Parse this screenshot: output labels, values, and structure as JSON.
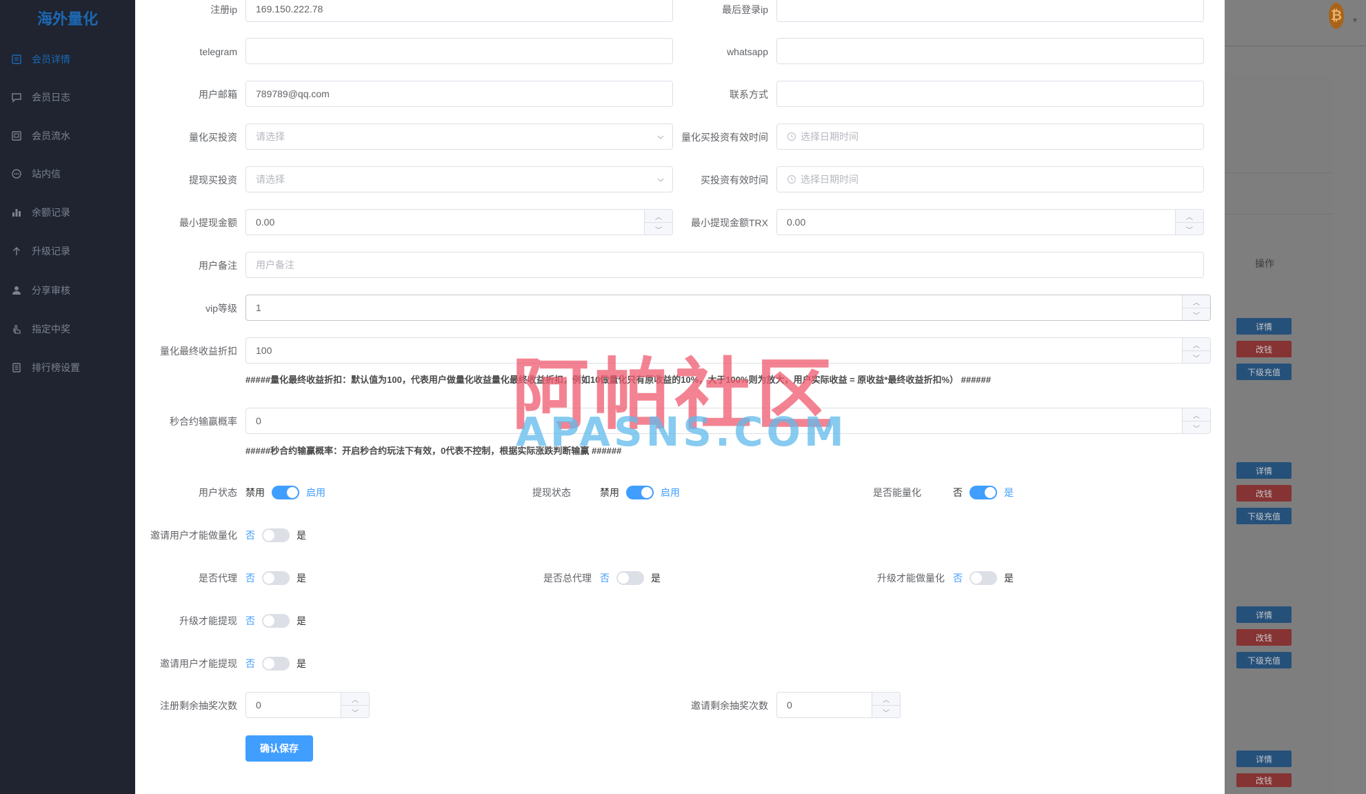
{
  "app": {
    "title": "海外量化"
  },
  "sidebar": {
    "items": [
      {
        "label": "会员详情",
        "icon": "document-icon",
        "active": true
      },
      {
        "label": "会员日志",
        "icon": "chat-icon"
      },
      {
        "label": "会员流水",
        "icon": "receipt-icon"
      },
      {
        "label": "站内信",
        "icon": "message-dots-icon"
      },
      {
        "label": "余额记录",
        "icon": "bar-chart-icon"
      },
      {
        "label": "升级记录",
        "icon": "arrow-up-icon"
      },
      {
        "label": "分享审核",
        "icon": "user-icon"
      },
      {
        "label": "指定中奖",
        "icon": "hand-pointer-icon"
      },
      {
        "label": "排行榜设置",
        "icon": "list-icon"
      }
    ]
  },
  "background": {
    "operation_header": "操作",
    "buttons": {
      "detail": "详情",
      "edit_money": "改钱",
      "recharge": "下级充值"
    },
    "accent": "#409eff"
  },
  "form": {
    "reg_ip": {
      "label": "注册ip",
      "value": "169.150.222.78"
    },
    "last_login_ip": {
      "label": "最后登录ip",
      "value": ""
    },
    "telegram": {
      "label": "telegram",
      "value": ""
    },
    "whatsapp": {
      "label": "whatsapp",
      "value": ""
    },
    "email": {
      "label": "用户邮箱",
      "value": "789789@qq.com"
    },
    "contact": {
      "label": "联系方式",
      "value": ""
    },
    "quant_invest": {
      "label": "量化买投资",
      "placeholder": "请选择"
    },
    "quant_invest_valid": {
      "label": "量化买投资有效时间",
      "placeholder": "选择日期时间"
    },
    "withdraw_invest": {
      "label": "提现买投资",
      "placeholder": "请选择"
    },
    "invest_valid": {
      "label": "买投资有效时间",
      "placeholder": "选择日期时间"
    },
    "min_withdraw": {
      "label": "最小提现金额",
      "value": "0.00"
    },
    "min_withdraw_trx": {
      "label": "最小提现金额TRX",
      "value": "0.00"
    },
    "remark": {
      "label": "用户备注",
      "placeholder": "用户备注"
    },
    "vip_level": {
      "label": "vip等级",
      "value": "1"
    },
    "quant_discount": {
      "label": "量化最终收益折扣",
      "value": "100",
      "hint": "#####量化最终收益折扣：默认值为100，代表用户做量化收益量化最终收益折扣，例如10做量化只有原收益的10%，大于100%则为放大，用户实际收益 = 原收益*最终收益折扣%） ######"
    },
    "second_contract": {
      "label": "秒合约输赢概率",
      "value": "0",
      "hint": "#####秒合约输赢概率：开启秒合约玩法下有效，0代表不控制，根据实际涨跌判断输赢 ######"
    },
    "user_status": {
      "label": "用户状态",
      "off": "禁用",
      "on": "启用",
      "checked": true
    },
    "withdraw_status": {
      "label": "提现状态",
      "off": "禁用",
      "on": "启用",
      "checked": true
    },
    "can_quant": {
      "label": "是否能量化",
      "off": "否",
      "on": "是",
      "checked": true
    },
    "invite_quant": {
      "label": "邀请用户才能做量化",
      "off": "否",
      "on": "是",
      "checked": false
    },
    "is_agent": {
      "label": "是否代理",
      "off": "否",
      "on": "是",
      "checked": false
    },
    "is_general_agent": {
      "label": "是否总代理",
      "off": "否",
      "on": "是",
      "checked": false
    },
    "upgrade_quant": {
      "label": "升级才能做量化",
      "off": "否",
      "on": "是",
      "checked": false
    },
    "upgrade_withdraw": {
      "label": "升级才能提现",
      "off": "否",
      "on": "是",
      "checked": false
    },
    "invite_withdraw": {
      "label": "邀请用户才能提现",
      "off": "否",
      "on": "是",
      "checked": false
    },
    "reg_lottery": {
      "label": "注册剩余抽奖次数",
      "value": "0"
    },
    "invite_lottery": {
      "label": "邀请剩余抽奖次数",
      "value": "0"
    },
    "submit": "确认保存"
  },
  "watermark": {
    "cn": "阿帕社区",
    "en": "APASNS.COM"
  }
}
